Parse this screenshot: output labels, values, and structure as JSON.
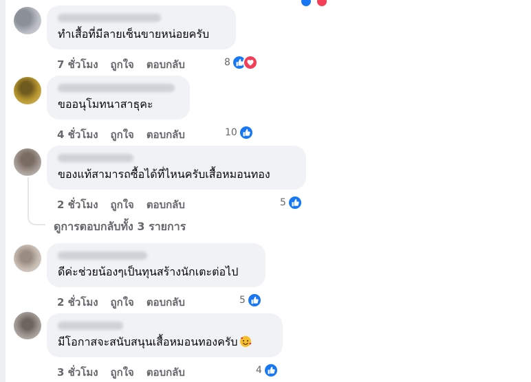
{
  "comments": [
    {
      "text": "ทำเสื้อที่มีลายเซ็นขายหน่อยครับ",
      "time": "7 ชั่วโมง",
      "like": "ถูกใจ",
      "reply": "ตอบกลับ",
      "react_count": "8",
      "reactions": [
        "like-icon",
        "love-icon"
      ]
    },
    {
      "text": "ขออนุโมทนาสาธุคะ",
      "time": "4 ชั่วโมง",
      "like": "ถูกใจ",
      "reply": "ตอบกลับ",
      "react_count": "10",
      "reactions": [
        "like-icon"
      ]
    },
    {
      "text": "ของแท้สามารถซื้อได้ที่ไหนครับเสื้อหมอนทอง",
      "time": "2 ชั่วโมง",
      "like": "ถูกใจ",
      "reply": "ตอบกลับ",
      "react_count": "5",
      "reactions": [
        "like-icon"
      ]
    },
    {
      "text": "ดีค่ะช่วยน้องๆเป็นทุนสร้างนักเตะต่อไป",
      "time": "2 ชั่วโมง",
      "like": "ถูกใจ",
      "reply": "ตอบกลับ",
      "react_count": "5",
      "reactions": [
        "like-icon"
      ]
    },
    {
      "text": "มีโอกาสจะสนับสนุนเสื้อหมอนทองครับ",
      "time": "3 ชั่วโมง",
      "like": "ถูกใจ",
      "reply": "ตอบกลับ",
      "react_count": "4",
      "reactions": [
        "like-icon"
      ],
      "trailing_emoji": "smiling-face-with-hearts-icon"
    }
  ],
  "view_replies": "ดูการตอบกลับทั้ง 3 รายการ",
  "colors": {
    "bubble": "#f0f2f5",
    "meta_text": "#65676b",
    "like_blue": "#1877f2",
    "love_red": "#f33e58"
  }
}
